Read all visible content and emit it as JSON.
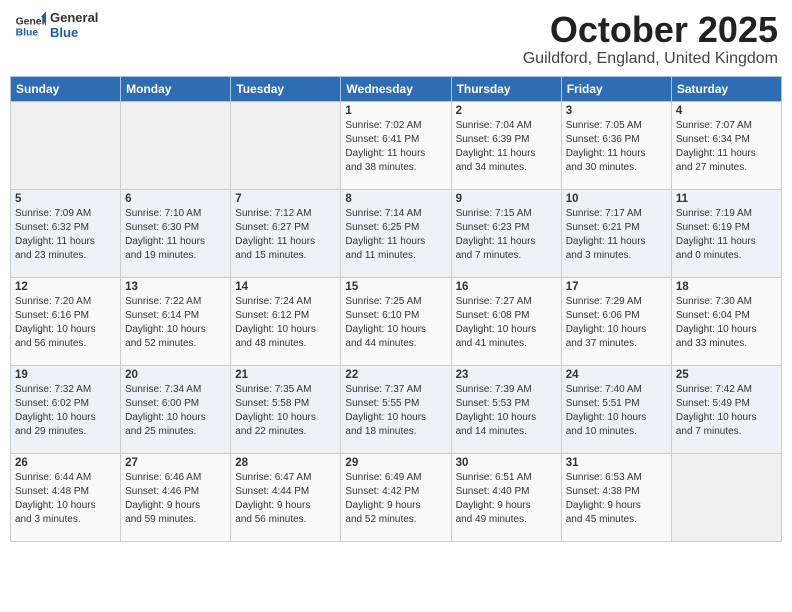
{
  "header": {
    "logo_line1": "General",
    "logo_line2": "Blue",
    "month": "October 2025",
    "location": "Guildford, England, United Kingdom"
  },
  "weekdays": [
    "Sunday",
    "Monday",
    "Tuesday",
    "Wednesday",
    "Thursday",
    "Friday",
    "Saturday"
  ],
  "weeks": [
    [
      {
        "day": "",
        "info": ""
      },
      {
        "day": "",
        "info": ""
      },
      {
        "day": "",
        "info": ""
      },
      {
        "day": "1",
        "info": "Sunrise: 7:02 AM\nSunset: 6:41 PM\nDaylight: 11 hours\nand 38 minutes."
      },
      {
        "day": "2",
        "info": "Sunrise: 7:04 AM\nSunset: 6:39 PM\nDaylight: 11 hours\nand 34 minutes."
      },
      {
        "day": "3",
        "info": "Sunrise: 7:05 AM\nSunset: 6:36 PM\nDaylight: 11 hours\nand 30 minutes."
      },
      {
        "day": "4",
        "info": "Sunrise: 7:07 AM\nSunset: 6:34 PM\nDaylight: 11 hours\nand 27 minutes."
      }
    ],
    [
      {
        "day": "5",
        "info": "Sunrise: 7:09 AM\nSunset: 6:32 PM\nDaylight: 11 hours\nand 23 minutes."
      },
      {
        "day": "6",
        "info": "Sunrise: 7:10 AM\nSunset: 6:30 PM\nDaylight: 11 hours\nand 19 minutes."
      },
      {
        "day": "7",
        "info": "Sunrise: 7:12 AM\nSunset: 6:27 PM\nDaylight: 11 hours\nand 15 minutes."
      },
      {
        "day": "8",
        "info": "Sunrise: 7:14 AM\nSunset: 6:25 PM\nDaylight: 11 hours\nand 11 minutes."
      },
      {
        "day": "9",
        "info": "Sunrise: 7:15 AM\nSunset: 6:23 PM\nDaylight: 11 hours\nand 7 minutes."
      },
      {
        "day": "10",
        "info": "Sunrise: 7:17 AM\nSunset: 6:21 PM\nDaylight: 11 hours\nand 3 minutes."
      },
      {
        "day": "11",
        "info": "Sunrise: 7:19 AM\nSunset: 6:19 PM\nDaylight: 11 hours\nand 0 minutes."
      }
    ],
    [
      {
        "day": "12",
        "info": "Sunrise: 7:20 AM\nSunset: 6:16 PM\nDaylight: 10 hours\nand 56 minutes."
      },
      {
        "day": "13",
        "info": "Sunrise: 7:22 AM\nSunset: 6:14 PM\nDaylight: 10 hours\nand 52 minutes."
      },
      {
        "day": "14",
        "info": "Sunrise: 7:24 AM\nSunset: 6:12 PM\nDaylight: 10 hours\nand 48 minutes."
      },
      {
        "day": "15",
        "info": "Sunrise: 7:25 AM\nSunset: 6:10 PM\nDaylight: 10 hours\nand 44 minutes."
      },
      {
        "day": "16",
        "info": "Sunrise: 7:27 AM\nSunset: 6:08 PM\nDaylight: 10 hours\nand 41 minutes."
      },
      {
        "day": "17",
        "info": "Sunrise: 7:29 AM\nSunset: 6:06 PM\nDaylight: 10 hours\nand 37 minutes."
      },
      {
        "day": "18",
        "info": "Sunrise: 7:30 AM\nSunset: 6:04 PM\nDaylight: 10 hours\nand 33 minutes."
      }
    ],
    [
      {
        "day": "19",
        "info": "Sunrise: 7:32 AM\nSunset: 6:02 PM\nDaylight: 10 hours\nand 29 minutes."
      },
      {
        "day": "20",
        "info": "Sunrise: 7:34 AM\nSunset: 6:00 PM\nDaylight: 10 hours\nand 25 minutes."
      },
      {
        "day": "21",
        "info": "Sunrise: 7:35 AM\nSunset: 5:58 PM\nDaylight: 10 hours\nand 22 minutes."
      },
      {
        "day": "22",
        "info": "Sunrise: 7:37 AM\nSunset: 5:55 PM\nDaylight: 10 hours\nand 18 minutes."
      },
      {
        "day": "23",
        "info": "Sunrise: 7:39 AM\nSunset: 5:53 PM\nDaylight: 10 hours\nand 14 minutes."
      },
      {
        "day": "24",
        "info": "Sunrise: 7:40 AM\nSunset: 5:51 PM\nDaylight: 10 hours\nand 10 minutes."
      },
      {
        "day": "25",
        "info": "Sunrise: 7:42 AM\nSunset: 5:49 PM\nDaylight: 10 hours\nand 7 minutes."
      }
    ],
    [
      {
        "day": "26",
        "info": "Sunrise: 6:44 AM\nSunset: 4:48 PM\nDaylight: 10 hours\nand 3 minutes."
      },
      {
        "day": "27",
        "info": "Sunrise: 6:46 AM\nSunset: 4:46 PM\nDaylight: 9 hours\nand 59 minutes."
      },
      {
        "day": "28",
        "info": "Sunrise: 6:47 AM\nSunset: 4:44 PM\nDaylight: 9 hours\nand 56 minutes."
      },
      {
        "day": "29",
        "info": "Sunrise: 6:49 AM\nSunset: 4:42 PM\nDaylight: 9 hours\nand 52 minutes."
      },
      {
        "day": "30",
        "info": "Sunrise: 6:51 AM\nSunset: 4:40 PM\nDaylight: 9 hours\nand 49 minutes."
      },
      {
        "day": "31",
        "info": "Sunrise: 6:53 AM\nSunset: 4:38 PM\nDaylight: 9 hours\nand 45 minutes."
      },
      {
        "day": "",
        "info": ""
      }
    ]
  ]
}
